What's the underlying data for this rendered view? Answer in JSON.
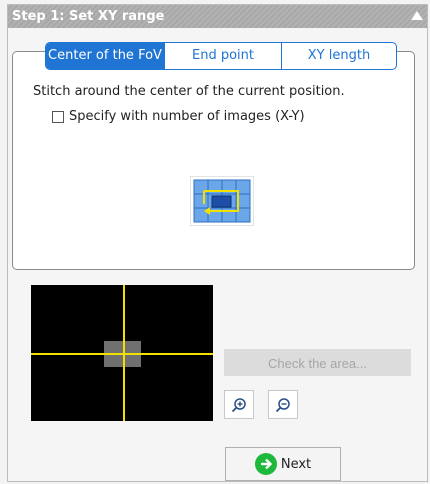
{
  "header": {
    "title": "Step 1: Set XY range",
    "collapse_icon": "collapse-up-arrow-icon"
  },
  "tabs": [
    {
      "label": "Center of the FoV",
      "active": true
    },
    {
      "label": "End point",
      "active": false
    },
    {
      "label": "XY length",
      "active": false
    }
  ],
  "description": "Stitch around the center of the current position.",
  "specify_checkbox": {
    "label": "Specify with number of images (X-Y)",
    "checked": false
  },
  "stitch_icon": "stitch-center-icon",
  "preview": {
    "crosshair_color": "#f1e100",
    "background": "#000000"
  },
  "check_area_button": {
    "label": "Check the area...",
    "enabled": false
  },
  "zoom_in_icon": "zoom-in-icon",
  "zoom_out_icon": "zoom-out-icon",
  "next_button": {
    "label": "Next",
    "icon": "arrow-right-circle-icon"
  },
  "colors": {
    "accent": "#1f74d4",
    "header_bg": "#a8a8a8",
    "next_icon": "#1eb83a"
  }
}
